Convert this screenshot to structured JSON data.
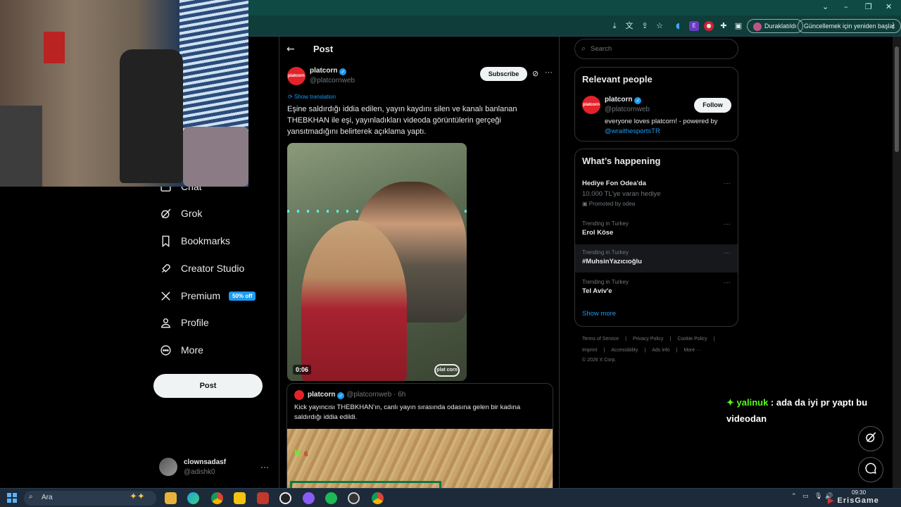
{
  "browser": {
    "paused_label": "Duraklatıldı",
    "update_label": "Güncellemek için yeniden başlat",
    "window_controls": [
      "⌄",
      "–",
      "❐",
      "✕"
    ]
  },
  "nav": {
    "items": [
      {
        "label": "Chat",
        "icon": "chat-icon"
      },
      {
        "label": "Grok",
        "icon": "grok-icon"
      },
      {
        "label": "Bookmarks",
        "icon": "bookmark-icon"
      },
      {
        "label": "Creator Studio",
        "icon": "rocket-icon"
      },
      {
        "label": "Premium",
        "icon": "x-logo-icon",
        "badge": "50% off"
      },
      {
        "label": "Profile",
        "icon": "person-icon"
      },
      {
        "label": "More",
        "icon": "more-circle-icon"
      }
    ],
    "post_button": "Post",
    "account": {
      "name": "clownsadasf",
      "handle": "@adishk0",
      "menu": "···"
    }
  },
  "post": {
    "header_title": "Post",
    "author": {
      "name": "platcorn",
      "handle": "@platcornweb",
      "avatar_text": "platcorn"
    },
    "subscribe_label": "Subscribe",
    "more": "···",
    "show_translation": "Show translation",
    "text": "Eşine saldırdığı iddia edilen, yayın kaydını silen ve kanalı banlanan THEBKHAN ile eşi, yayınladıkları videoda görüntülerin gerçeği yansıtmadığını belirterek açıklama yaptı.",
    "video": {
      "duration": "0:06",
      "watermark": "plat corn"
    },
    "quote": {
      "name": "platcorn",
      "handle": "@platcornweb",
      "time": "· 6h",
      "text": "Kick yayıncısı THEBKHAN'ın, canlı yayın sırasında odasına gelen bir kadına saldırdığı iddia edildi.",
      "kick_logo": "K",
      "kick_count": "6"
    }
  },
  "right": {
    "search_placeholder": "Search",
    "relevant": {
      "title": "Relevant people",
      "name": "platcorn",
      "handle": "@platcornweb",
      "follow": "Follow",
      "bio": "everyone loves platcorn! - powered by",
      "bio_link": "@wraithesportsTR"
    },
    "happening": {
      "title": "What’s happening",
      "promo": {
        "title": "Hediye Fon Odea'da",
        "sub": "10.000 TL'ye varan hediye",
        "by": "Promoted by odea"
      },
      "trends": [
        {
          "meta": "Trending in Turkey",
          "title": "Erol Köse"
        },
        {
          "meta": "Trending in Turkey",
          "title": "#MuhsinYazıcıoğlu"
        },
        {
          "meta": "Trending in Turkey",
          "title": "Tel Aviv'e"
        }
      ],
      "show_more": "Show more",
      "dots": "···"
    },
    "footer": {
      "row1": [
        "Terms of Service",
        "|",
        "Privacy Policy",
        "|",
        "Cookie Policy",
        "|"
      ],
      "row2": [
        "Imprint",
        "|",
        "Accessibility",
        "|",
        "Ads info",
        "|",
        "More ···"
      ],
      "copyright": "© 2026 X Corp."
    }
  },
  "chat": {
    "user": "yalinuk",
    "message": " : ada da iyi pr yaptı bu videodan"
  },
  "taskbar": {
    "search": "Ara",
    "clock": "09:30"
  },
  "watermark": {
    "brand": "ErisGame"
  },
  "colors": {
    "accent": "#1d9bf0",
    "kick_green": "#53fc18",
    "background": "#000000"
  }
}
